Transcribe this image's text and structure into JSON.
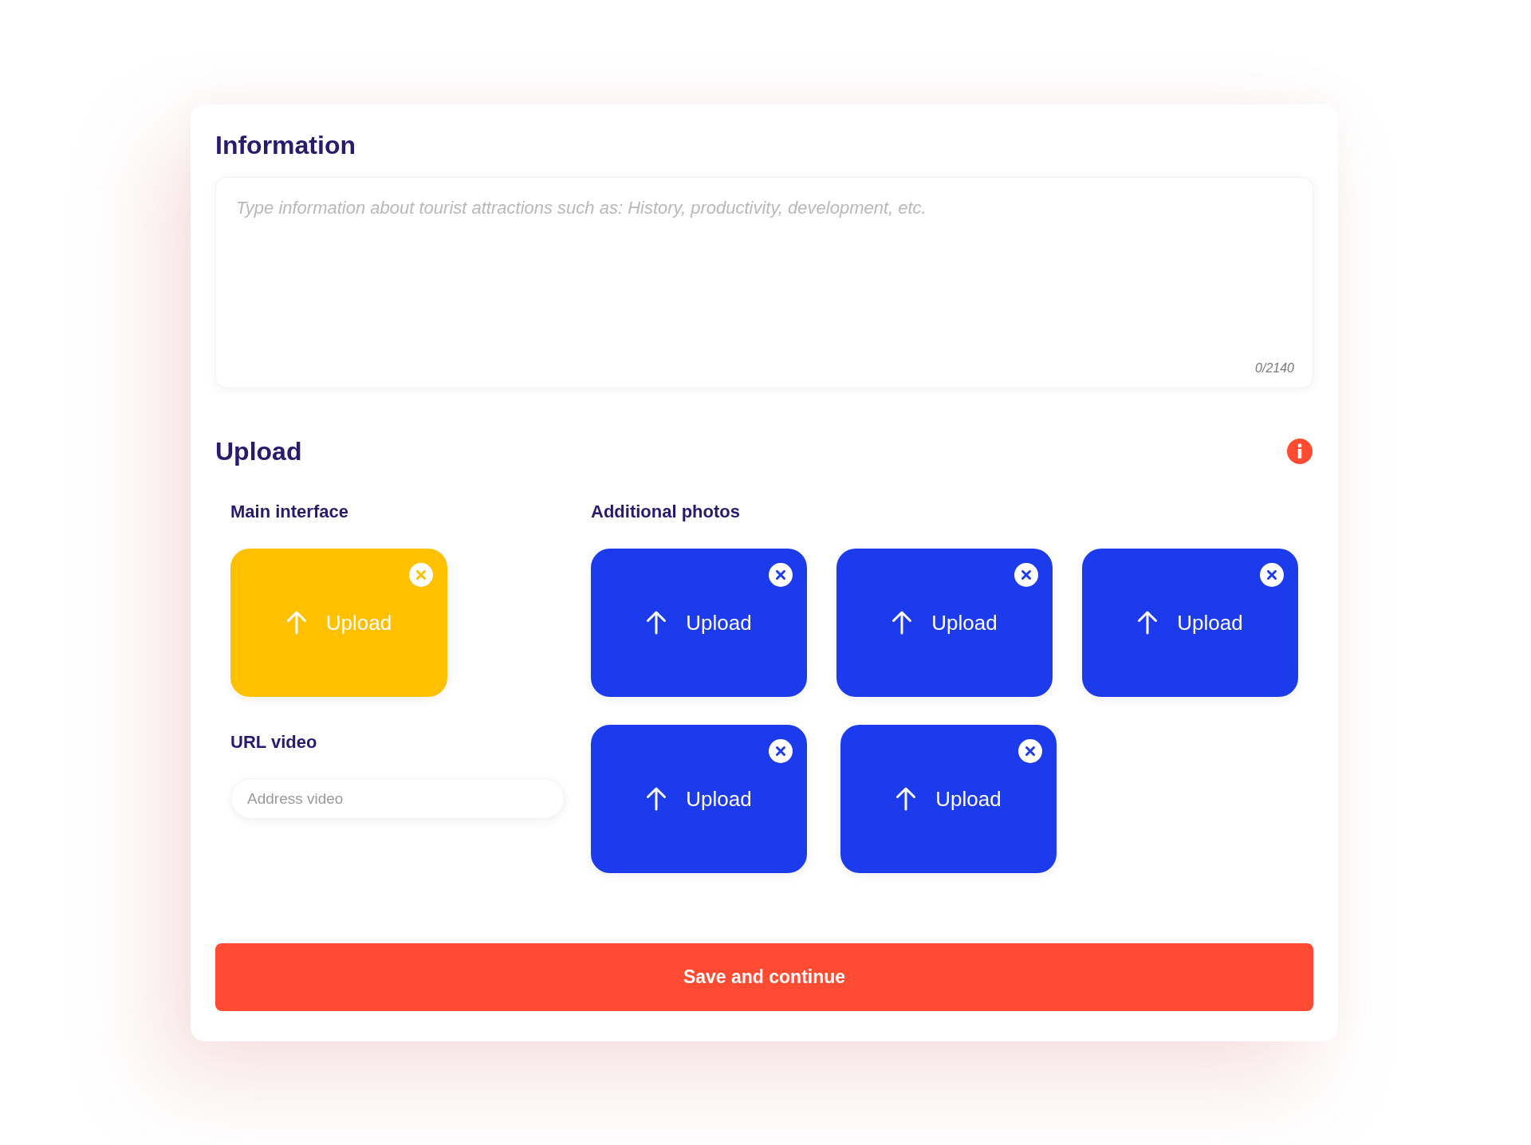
{
  "information": {
    "title": "Information",
    "placeholder": "Type information about tourist attractions such as: History, productivity, development, etc.",
    "counter": "0/2140"
  },
  "upload": {
    "title": "Upload",
    "main_interface": {
      "label": "Main interface",
      "tile": {
        "label": "Upload"
      }
    },
    "url_video": {
      "label": "URL video",
      "placeholder": "Address video"
    },
    "additional_photos": {
      "label": "Additional photos",
      "tiles": [
        {
          "label": "Upload"
        },
        {
          "label": "Upload"
        },
        {
          "label": "Upload"
        },
        {
          "label": "Upload"
        },
        {
          "label": "Upload"
        }
      ]
    }
  },
  "save_button": "Save and continue"
}
